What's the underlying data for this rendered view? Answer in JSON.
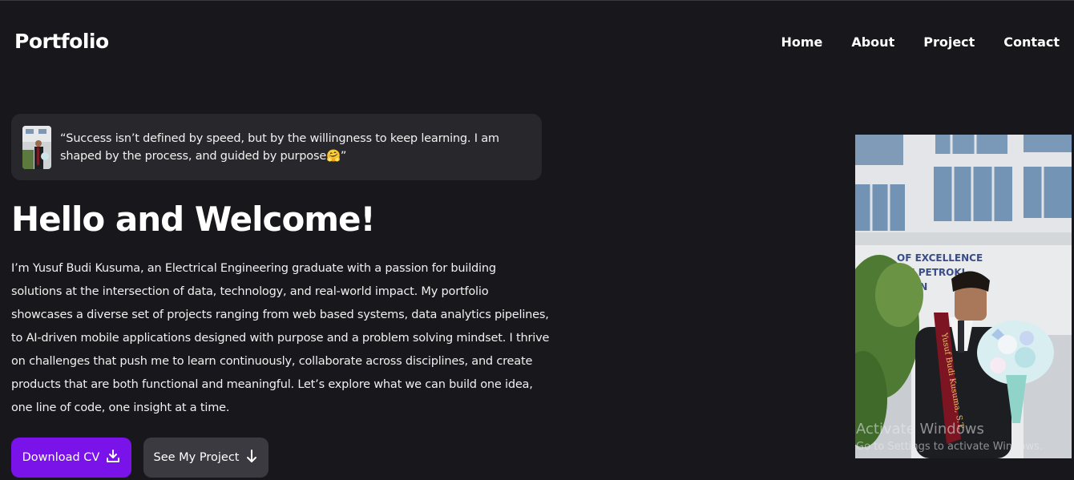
{
  "brand": "Portfolio",
  "nav": {
    "home": "Home",
    "about": "About",
    "project": "Project",
    "contact": "Contact"
  },
  "quote": {
    "text": "“Success isn’t defined by speed, but by the willingness to keep learning. I am shaped by the process, and guided by purpose🤗”"
  },
  "hero": {
    "title": "Hello and Welcome!",
    "description": "I’m Yusuf Budi Kusuma, an Electrical Engineering graduate with a passion for building solutions at the intersection of data, technology, and real-world impact. My portfolio showcases a diverse set of projects ranging from web based systems, data analytics pipelines, to AI-driven mobile applications designed with purpose and a problem solving mindset. I thrive on challenges that push me to learn continuously, collaborate across disciplines, and create products that are both functional and meaningful. Let’s explore what we can build one idea, one line of code, one insight at a time."
  },
  "buttons": {
    "download_cv": "Download CV",
    "see_project": "See My Project"
  },
  "photo": {
    "building_sign_line1": "OF EXCELLENCE",
    "building_sign_line2": "STRI PETROKI",
    "building_sign_line3": "EGON",
    "sash_text": "Yusuf Budi Kusuma, S.T."
  },
  "overlay": {
    "title": "Activate Windows",
    "subtitle": "Go to Settings to activate Windows."
  },
  "colors": {
    "background": "#18171b",
    "card": "#28272b",
    "primary_button": "#7a12ea",
    "secondary_button": "#3a3a40"
  }
}
